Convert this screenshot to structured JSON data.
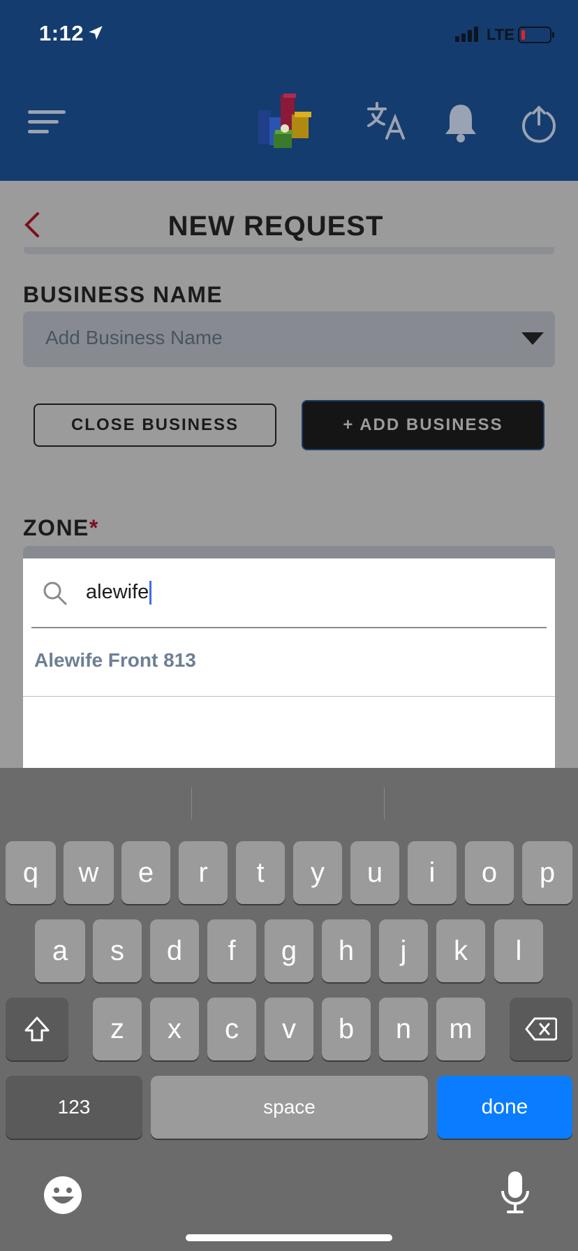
{
  "status_bar": {
    "time": "1:12",
    "network": "LTE"
  },
  "header": {
    "menu_icon": "menu-icon",
    "logo_icon": "buildings-logo",
    "translate_icon": "translate-icon",
    "notifications_icon": "bell-icon",
    "logout_icon": "power-icon",
    "background": "#143c6e"
  },
  "page": {
    "title": "NEW REQUEST",
    "back_icon": "chevron-left-icon"
  },
  "business": {
    "label": "BUSINESS NAME",
    "placeholder": "Add Business Name",
    "close_button": "CLOSE BUSINESS",
    "add_button": "+ ADD BUSINESS"
  },
  "zone": {
    "label": "ZONE",
    "required_marker": "*",
    "search_value": "alewife",
    "results": [
      {
        "label": "Alewife Front 813"
      }
    ]
  },
  "keyboard": {
    "row1": [
      "q",
      "w",
      "e",
      "r",
      "t",
      "y",
      "u",
      "i",
      "o",
      "p"
    ],
    "row2": [
      "a",
      "s",
      "d",
      "f",
      "g",
      "h",
      "j",
      "k",
      "l"
    ],
    "row3": [
      "z",
      "x",
      "c",
      "v",
      "b",
      "n",
      "m"
    ],
    "numbers_key": "123",
    "space_key": "space",
    "done_key": "done",
    "accent": "#0a7cff"
  }
}
